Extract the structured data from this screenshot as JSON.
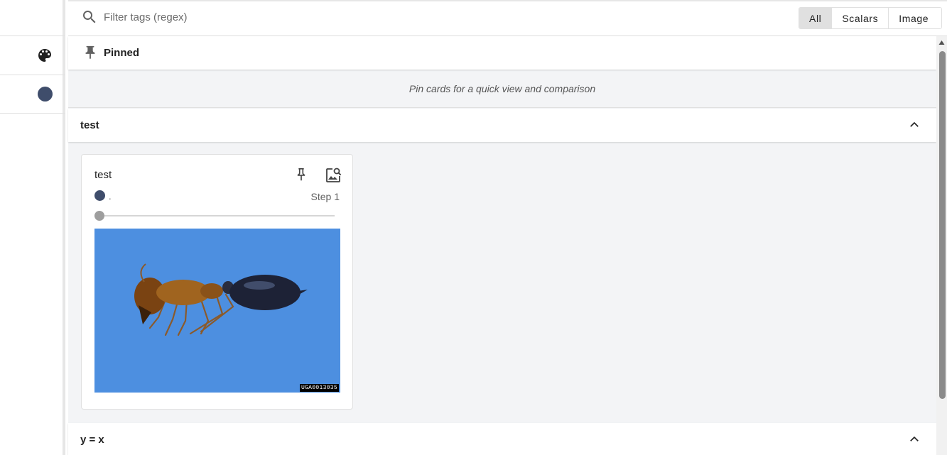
{
  "sidebar": {
    "palette_icon": "palette-icon",
    "run_color": "#3f4d6b"
  },
  "search": {
    "placeholder": "Filter tags (regex)",
    "value": ""
  },
  "filters": {
    "options": [
      "All",
      "Scalars",
      "Image"
    ],
    "selected": "All"
  },
  "pinned": {
    "title": "Pinned",
    "empty_message": "Pin cards for a quick view and comparison"
  },
  "groups": [
    {
      "title": "test",
      "expanded": true,
      "cards": [
        {
          "title": "test",
          "run_name": ".",
          "run_color": "#3f4d6b",
          "step_label": "Step 1",
          "image_tag": "UGA0013035"
        }
      ]
    },
    {
      "title": "y = x",
      "expanded": true
    }
  ],
  "colors": {
    "accent_selected": "#e0e0e0",
    "image_background": "#4d8fe0"
  }
}
